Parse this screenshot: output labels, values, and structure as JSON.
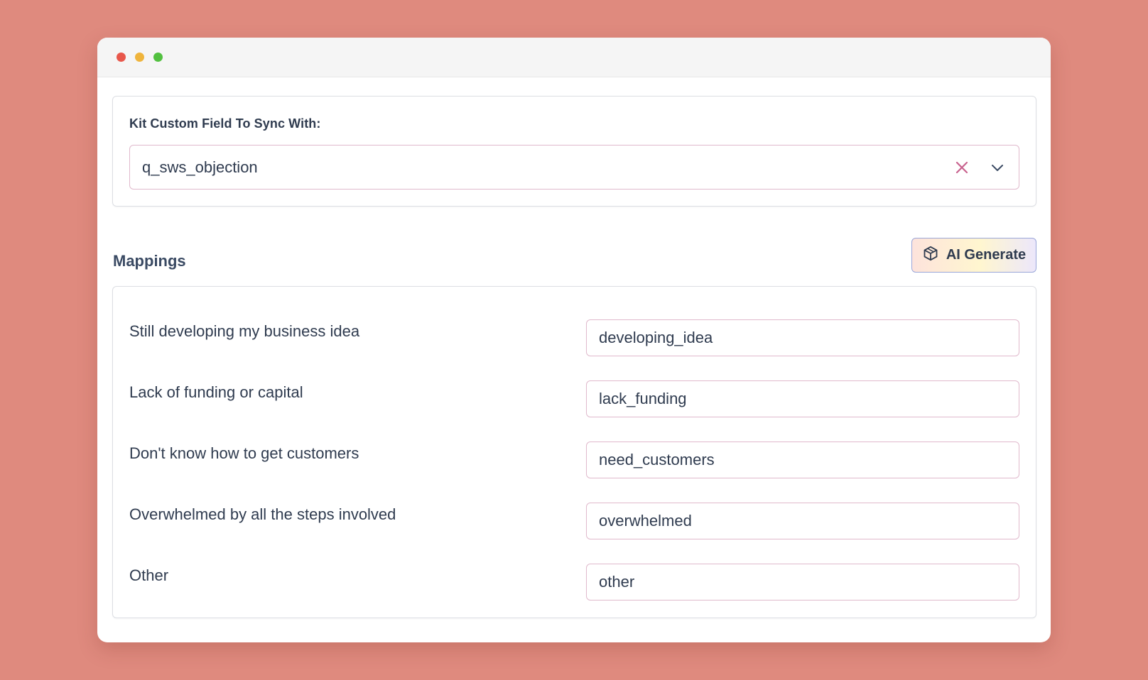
{
  "window": {
    "traffic_lights": [
      {
        "name": "close",
        "color": "#e8574b"
      },
      {
        "name": "minimize",
        "color": "#efb43c"
      },
      {
        "name": "maximize",
        "color": "#52c03f"
      }
    ]
  },
  "sync": {
    "label": "Kit Custom Field To Sync With:",
    "selected_value": "q_sws_objection",
    "clear_icon": "close-icon",
    "dropdown_icon": "chevron-down-icon"
  },
  "mappings": {
    "title": "Mappings",
    "ai_button_label": "AI Generate",
    "ai_button_icon": "cube-icon",
    "rows": [
      {
        "label": "Still developing my business idea",
        "value": "developing_idea"
      },
      {
        "label": "Lack of funding or capital",
        "value": "lack_funding"
      },
      {
        "label": "Don't know how to get customers",
        "value": "need_customers"
      },
      {
        "label": "Overwhelmed by all the steps involved",
        "value": "overwhelmed"
      },
      {
        "label": "Other",
        "value": "other"
      }
    ]
  },
  "colors": {
    "background": "#df8a7e",
    "input_border": "#e0b9cc",
    "clear_icon": "#c8628e",
    "text": "#2f3b4f"
  }
}
